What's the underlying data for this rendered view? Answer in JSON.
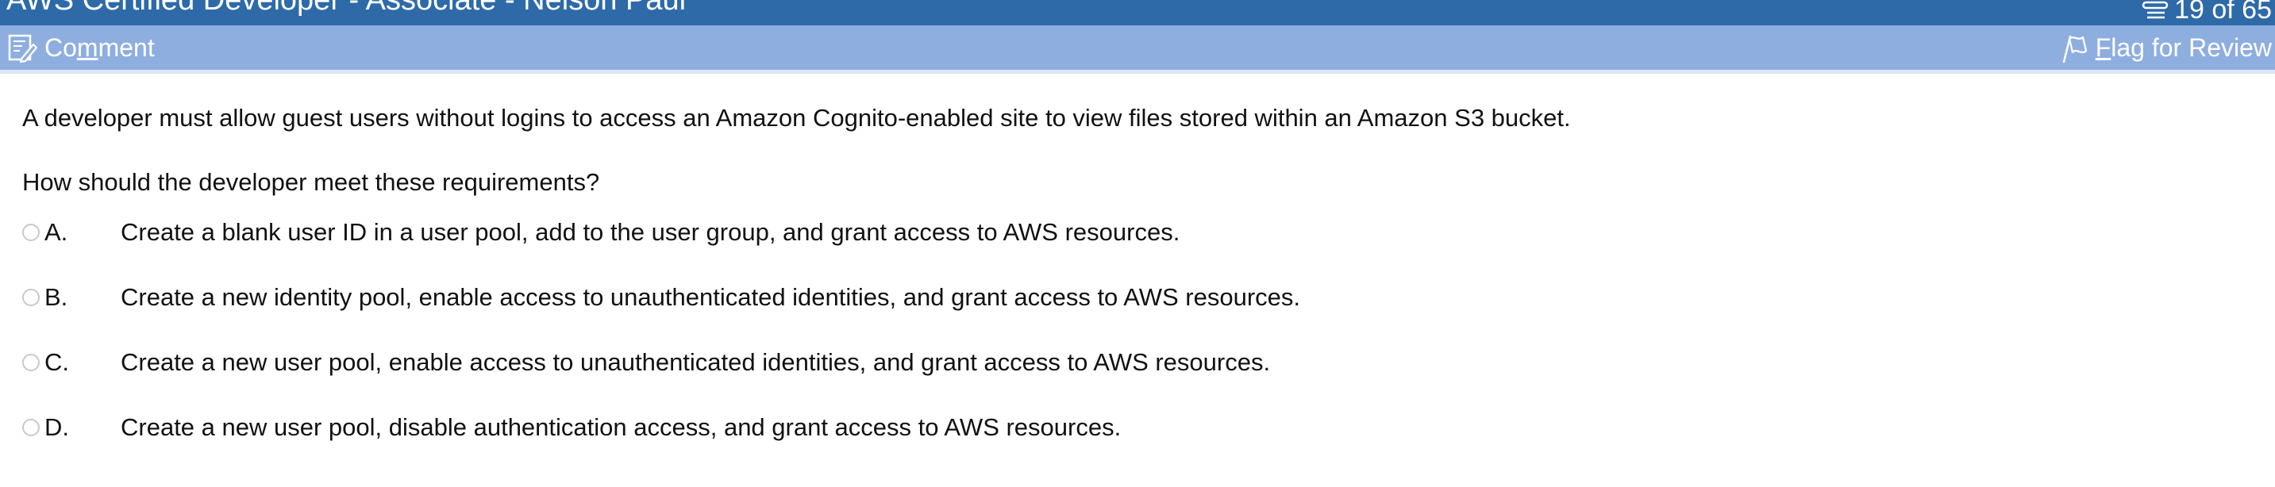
{
  "window": {
    "title": "AWS Certified Developer - Associate - Nelson Paul",
    "progress": "19 of 65",
    "progress_icon": "list-icon"
  },
  "toolbar": {
    "comment": {
      "label_pre": "Co",
      "label_accel": "m",
      "label_post": "ment",
      "icon": "comment-icon"
    },
    "flag": {
      "label_accel": "F",
      "label_post": "lag for Review",
      "icon": "flag-icon"
    }
  },
  "question": {
    "stem": "A developer must allow guest users without logins to access an Amazon Cognito-enabled site to view files stored within an Amazon S3 bucket.",
    "prompt": "How should the developer meet these requirements?",
    "options": [
      {
        "letter": "A.",
        "text": "Create a blank user ID in a user pool, add to the user group, and grant access to AWS resources."
      },
      {
        "letter": "B.",
        "text": "Create a new identity pool, enable access to unauthenticated identities, and grant access to AWS resources."
      },
      {
        "letter": "C.",
        "text": "Create a new user pool, enable access to unauthenticated identities, and grant access to AWS resources."
      },
      {
        "letter": "D.",
        "text": "Create a new user pool, disable authentication access, and grant access to AWS resources."
      }
    ]
  },
  "colors": {
    "title_bar": "#2e6aa8",
    "toolbar": "#8eaee0",
    "toolbar_border": "#dde6f4",
    "text": "#111111"
  }
}
